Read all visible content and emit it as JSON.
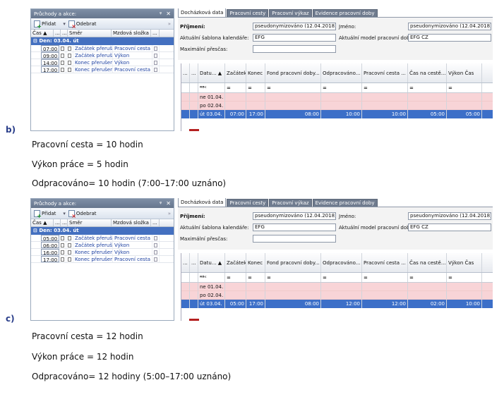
{
  "panels": [
    {
      "id": "b",
      "letter": "b)",
      "left_panel": {
        "title": "Průchody a akce:",
        "pin": "ᵠ",
        "close": "✕",
        "toolbar": {
          "add": "Přidat",
          "remove": "Odebrat"
        },
        "headers": {
          "cas": "Čas",
          "sort": "▲",
          "dots1": "...",
          "dots2": "...",
          "smer": "Směr",
          "mzd": "Mzdová složka",
          "dots3": "..."
        },
        "group": "Den: 03.04. út",
        "rows": [
          {
            "time": "07:00",
            "smer": "Začátek přerušení",
            "mzd": "Pracovní cesta"
          },
          {
            "time": "09:00",
            "smer": "Začátek přerušení",
            "mzd": "Výkon"
          },
          {
            "time": "14:00",
            "smer": "Konec přerušení",
            "mzd": "Výkon"
          },
          {
            "time": "17:00",
            "smer": "Konec přerušení",
            "mzd": "Pracovní cesta"
          }
        ]
      },
      "right_panel": {
        "tabs": [
          "Docházková data",
          "Pracovní cesty",
          "Pracovní výkaz",
          "Evidence pracovní doby"
        ],
        "form": {
          "prijmeni_label": "Příjmení:",
          "prijmeni_value": "pseudonymizováno (12.04.2018)",
          "jmeno_label": "Jméno:",
          "jmeno_value": "pseudonymizováno (12.04.2018)",
          "sablona_label": "Aktuální šablona kalendáře:",
          "sablona_value": "EFG",
          "model_label": "Aktuální model pracovní doby:",
          "model_value": "EFG CZ",
          "presas_label": "Maximální přesčas:",
          "presas_value": ""
        },
        "grid_headers": [
          "...",
          "...",
          "Datu... ▲",
          "Začátek",
          "Konec",
          "Fond pracovní doby...",
          "Odpracováno...",
          "Pracovní cesta ...",
          "Čas na cestě...",
          "Výkon Čas"
        ],
        "filter": {
          "icon": "ᴿᴮᶜ",
          "eq": "="
        },
        "rows": [
          {
            "date": "ne 01.04.",
            "start": "",
            "end": "",
            "fond": "",
            "odprac": "",
            "cesta": "",
            "cas": "",
            "vykon": ""
          },
          {
            "date": "po 02.04.",
            "start": "",
            "end": "",
            "fond": "",
            "odprac": "",
            "cesta": "",
            "cas": "",
            "vykon": ""
          },
          {
            "date": "út 03.04.",
            "start": "07:00",
            "end": "17:00",
            "fond": "08:00",
            "odprac": "10:00",
            "cesta": "10:00",
            "cas": "05:00",
            "vykon": "05:00"
          }
        ]
      },
      "captions": [
        "Pracovní cesta = 10 hodin",
        "Výkon práce = 5 hodin",
        "Odpracováno= 10 hodin (7:00–17:00 uznáno)"
      ]
    },
    {
      "id": "c",
      "letter": "c)",
      "left_panel": {
        "title": "Průchody a akce:",
        "pin": "ᵠ",
        "close": "✕",
        "toolbar": {
          "add": "Přidat",
          "remove": "Odebrat"
        },
        "headers": {
          "cas": "Čas",
          "sort": "▲",
          "dots1": "...",
          "dots2": "...",
          "smer": "Směr",
          "mzd": "Mzdová složka",
          "dots3": "..."
        },
        "group": "Den: 03.04. út",
        "rows": [
          {
            "time": "05:00",
            "smer": "Začátek přerušení",
            "mzd": "Pracovní cesta"
          },
          {
            "time": "06:00",
            "smer": "Začátek přerušení",
            "mzd": "Výkon"
          },
          {
            "time": "16:00",
            "smer": "Konec přerušení",
            "mzd": "Výkon"
          },
          {
            "time": "17:00",
            "smer": "Konec přerušení",
            "mzd": "Pracovní cesta"
          }
        ]
      },
      "right_panel": {
        "tabs": [
          "Docházková data",
          "Pracovní cesty",
          "Pracovní výkaz",
          "Evidence pracovní doby"
        ],
        "form": {
          "prijmeni_label": "Příjmení:",
          "prijmeni_value": "pseudonymizováno (12.04.2018)",
          "jmeno_label": "Jméno:",
          "jmeno_value": "pseudonymizováno (12.04.2018)",
          "sablona_label": "Aktuální šablona kalendáře:",
          "sablona_value": "EFG",
          "model_label": "Aktuální model pracovní doby:",
          "model_value": "EFG CZ",
          "presas_label": "Maximální přesčas:",
          "presas_value": ""
        },
        "grid_headers": [
          "...",
          "...",
          "Datu... ▲",
          "Začátek",
          "Konec",
          "Fond pracovní doby...",
          "Odpracováno...",
          "Pracovní cesta ...",
          "Čas na cestě...",
          "Výkon Čas"
        ],
        "filter": {
          "icon": "ᴿᴮᶜ",
          "eq": "="
        },
        "rows": [
          {
            "date": "ne 01.04.",
            "start": "",
            "end": "",
            "fond": "",
            "odprac": "",
            "cesta": "",
            "cas": "",
            "vykon": ""
          },
          {
            "date": "po 02.04.",
            "start": "",
            "end": "",
            "fond": "",
            "odprac": "",
            "cesta": "",
            "cas": "",
            "vykon": ""
          },
          {
            "date": "út 03.04.",
            "start": "05:00",
            "end": "17:00",
            "fond": "08:00",
            "odprac": "12:00",
            "cesta": "12:00",
            "cas": "02:00",
            "vykon": "10:00"
          }
        ]
      },
      "captions": [
        "Pracovní cesta = 12 hodin",
        "Výkon práce = 12 hodin",
        "Odpracováno= 12 hodiny (5:00–17:00 uznáno)"
      ]
    }
  ]
}
